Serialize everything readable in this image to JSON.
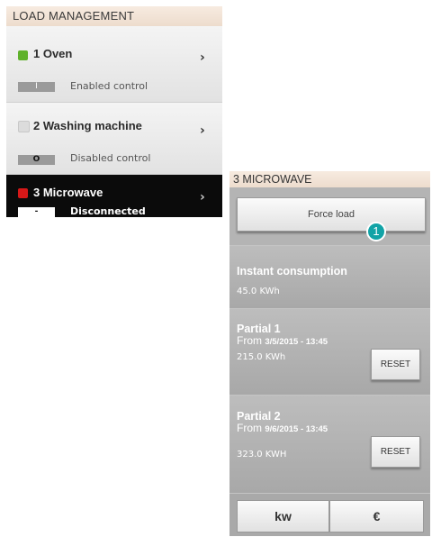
{
  "load_management": {
    "title": "LOAD MANAGEMENT",
    "items": [
      {
        "number_name": "1 Oven",
        "status": "Enabled control",
        "toggle": "I",
        "indicator_color": "#5fb12b",
        "chevron": "›"
      },
      {
        "number_name": "2 Washing machine",
        "status": "Disabled control",
        "toggle": "O",
        "indicator_color": "#dcdcdc",
        "chevron": "›"
      },
      {
        "number_name": "3 Microwave",
        "status": "Disconnected",
        "toggle": "-",
        "indicator_color": "#d61818",
        "chevron": "›"
      }
    ]
  },
  "microwave": {
    "title": "3 MICROWAVE",
    "force_label": "Force load",
    "badge": "1",
    "instant": {
      "title": "Instant consumption",
      "value": "45.0 KWh"
    },
    "partial1": {
      "title": "Partial 1",
      "from_label": "From",
      "from_date": "3/5/2015 - 13:45",
      "value": "215.0 KWh",
      "reset_label": "RESET"
    },
    "partial2": {
      "title": "Partial 2",
      "from_label": "From",
      "from_date": "9/6/2015 - 13:45",
      "value": "323.0 KWH",
      "reset_label": "RESET"
    },
    "units": {
      "kw_label": "kw",
      "euro_label": "€"
    }
  }
}
